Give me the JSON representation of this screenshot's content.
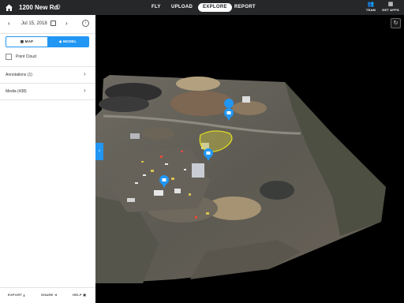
{
  "topbar": {
    "home_icon": "home-icon",
    "site_title": "1200 New Rd.",
    "settings_icon": "gear-icon",
    "nav": [
      "FLY",
      "UPLOAD",
      "EXPLORE",
      "REPORT"
    ],
    "active_nav": "EXPLORE",
    "team_label": "TEAM",
    "get_apps_label": "GET APPS"
  },
  "sidebar": {
    "date": "Jul 15, 2018",
    "view_toggle": {
      "map_label": "MAP",
      "model_label": "MODEL",
      "selected": "MODEL"
    },
    "point_cloud_label": "Point Cloud",
    "sections": [
      "Annotations (1)",
      "Media (438)"
    ],
    "footer": {
      "export_label": "EXPORT",
      "share_label": "SHARE",
      "help_label": "HELP"
    }
  },
  "viewport": {
    "refresh_icon": "refresh-icon",
    "collapse_icon": "chevron-left-icon",
    "markers": [
      "camera-marker-icon",
      "camera-marker-icon",
      "camera-marker-icon"
    ],
    "annotation": "polygon-annotation"
  },
  "colors": {
    "topbar_bg": "#262729",
    "accent": "#2196f3",
    "annotation_stroke": "#e8e020",
    "annotation_fill": "#c8c040"
  }
}
